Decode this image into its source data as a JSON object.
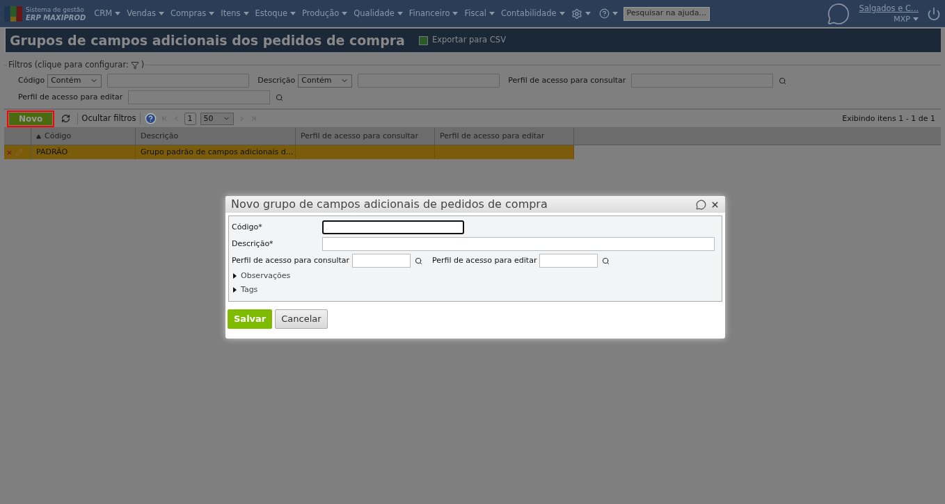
{
  "header": {
    "logo_subtitle": "Sistema de gestão",
    "logo_name": "ERP MAXIPROD",
    "menus": [
      "CRM",
      "Vendas",
      "Compras",
      "Itens",
      "Estoque",
      "Produção",
      "Qualidade",
      "Financeiro",
      "Fiscal",
      "Contabilidade"
    ],
    "search_placeholder": "Pesquisar na ajuda...",
    "company": "Salgados e C...",
    "user": "MXP"
  },
  "page": {
    "title": "Grupos de campos adicionais dos pedidos de compra",
    "export_label": "Exportar para CSV"
  },
  "filters": {
    "legend": "Filtros (clique para configurar:",
    "legend_end": ")",
    "rows": [
      [
        {
          "kind": "match",
          "label": "Código",
          "operator": "Contém"
        },
        {
          "kind": "match",
          "label": "Descrição",
          "operator": "Contém"
        },
        {
          "kind": "lookup",
          "label": "Perfil de acesso para consultar"
        }
      ],
      [
        {
          "kind": "lookup",
          "label": "Perfil de acesso para editar"
        }
      ]
    ]
  },
  "toolbar": {
    "new_button": {
      "label": "Novo",
      "highlighted": true
    },
    "hide_filters": "Ocultar filtros",
    "page": "1",
    "page_size": "50",
    "summary": "Exibindo itens 1 - 1 de 1"
  },
  "table": {
    "columns": [
      {
        "label": "Código",
        "sorted": true
      },
      {
        "label": "Descrição",
        "sorted": false
      },
      {
        "label": "Perfil de acesso para consultar",
        "sorted": false
      },
      {
        "label": "Perfil de acesso para editar",
        "sorted": false
      }
    ],
    "rows": [
      {
        "selected": true,
        "cells": [
          "PADRÃO",
          "Grupo padrão de campos adicionais d...",
          "",
          ""
        ]
      }
    ]
  },
  "dialog": {
    "title": "Novo grupo de campos adicionais de pedidos de compra",
    "fields": [
      {
        "kind": "text",
        "label": "Código*",
        "focused": true
      },
      {
        "kind": "text",
        "label": "Descrição*",
        "focused": false
      }
    ],
    "lookups": [
      "Perfil de acesso para consultar",
      "Perfil de acesso para editar"
    ],
    "sections": [
      {
        "label": "Observações",
        "expanded": false
      },
      {
        "label": "Tags",
        "expanded": false
      }
    ],
    "buttons": [
      {
        "kind": "primary",
        "label": "Salvar"
      },
      {
        "kind": "secondary",
        "label": "Cancelar"
      }
    ]
  }
}
